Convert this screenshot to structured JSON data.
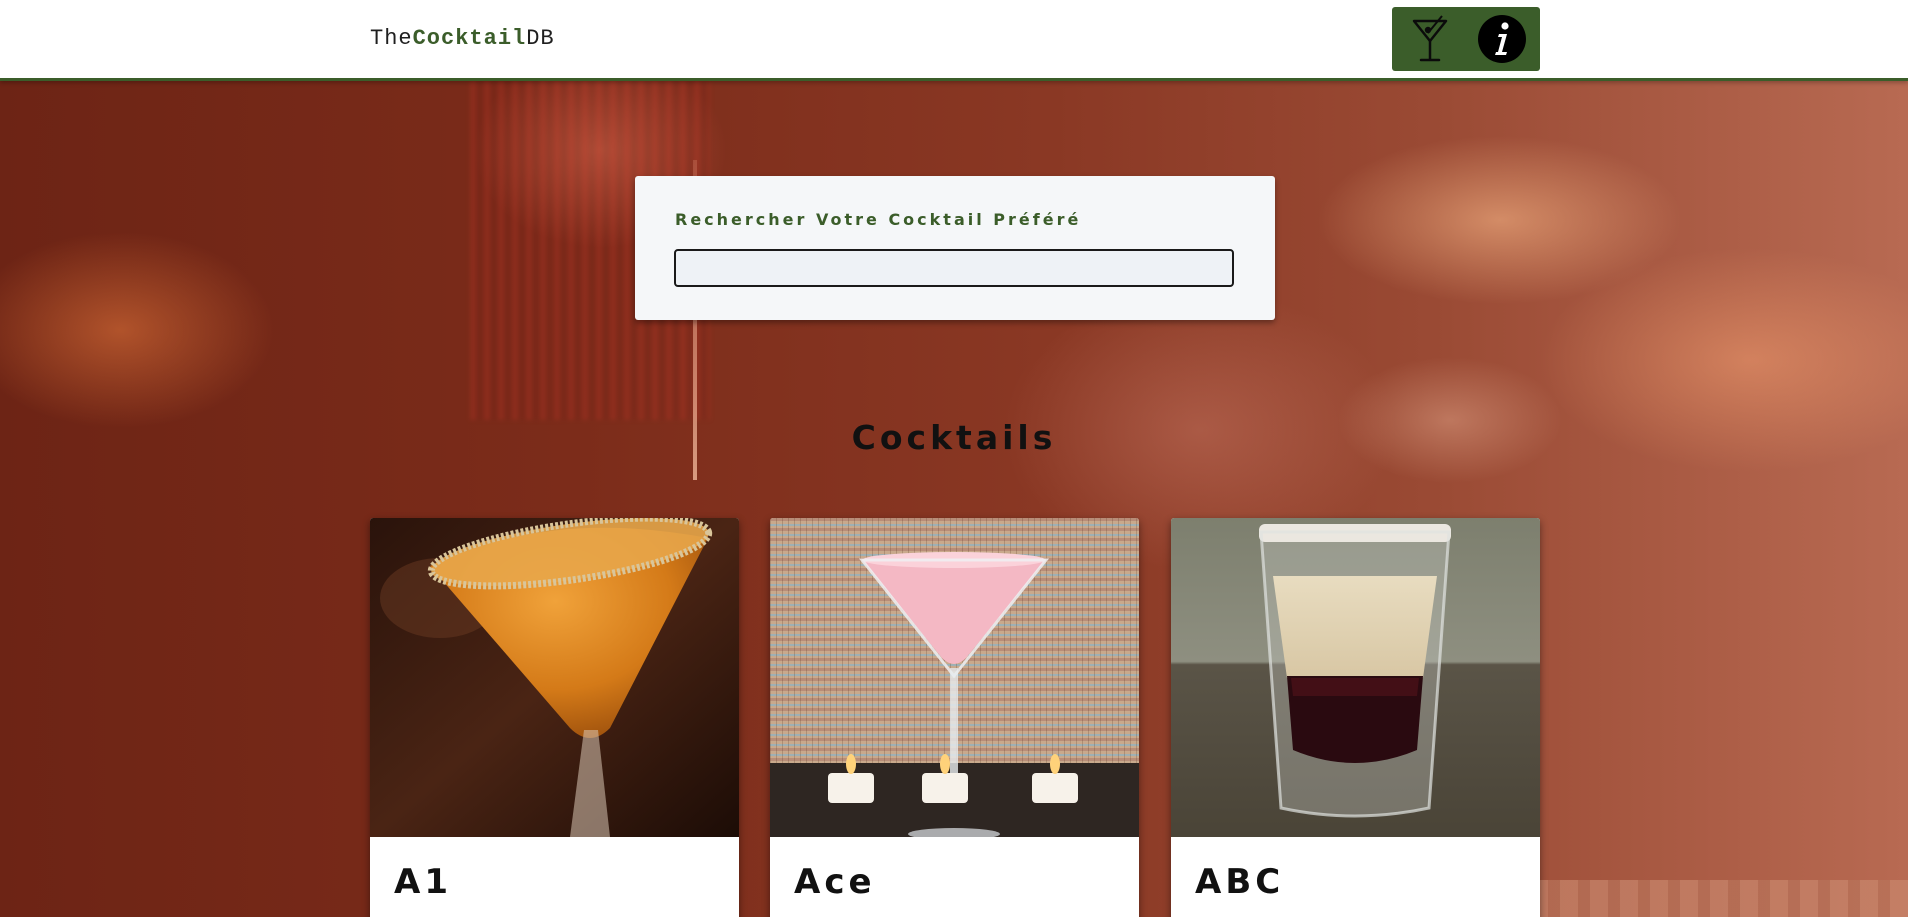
{
  "header": {
    "brand_prefix": "The",
    "brand_strong": "Cocktail",
    "brand_suffix": "DB",
    "nav_icons": [
      "cocktail-glass-icon",
      "info-icon"
    ]
  },
  "search": {
    "label": "Rechercher Votre Cocktail Préféré",
    "value": "",
    "placeholder": ""
  },
  "section": {
    "title": "Cocktails"
  },
  "cards": [
    {
      "name": "A1",
      "image": "orange-martini-photo"
    },
    {
      "name": "Ace",
      "image": "pink-martini-photo"
    },
    {
      "name": "ABC",
      "image": "layered-shot-photo"
    }
  ],
  "colors": {
    "brand_green": "#3b5d2a",
    "header_bg": "#ffffff",
    "panel_bg": "#f5f7f9",
    "page_bg": "#7a2e1c"
  }
}
